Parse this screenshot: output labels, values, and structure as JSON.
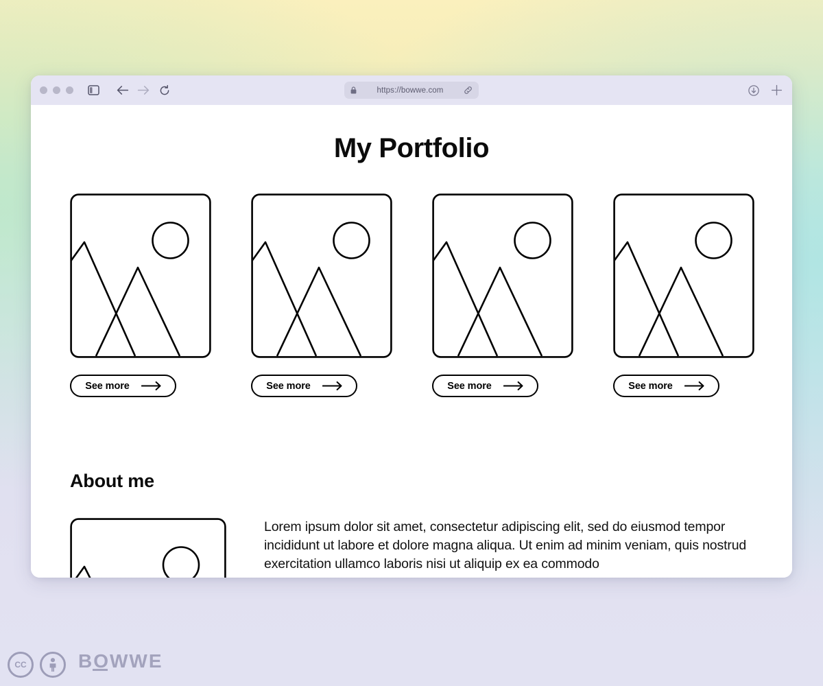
{
  "browser": {
    "traffic_lights": [
      "close",
      "minimize",
      "maximize"
    ],
    "sidebar_toggle_icon": "sidebar-icon",
    "back_icon": "arrow-left-icon",
    "forward_icon": "arrow-right-icon",
    "reload_icon": "reload-icon",
    "lock_icon": "lock-icon",
    "url": "https://bowwe.com",
    "link_icon": "link-icon",
    "download_icon": "download-icon",
    "new_tab_icon": "plus-icon"
  },
  "page": {
    "title": "My Portfolio",
    "portfolio_items": [
      {
        "image_alt": "image-placeholder",
        "button_label": "See more"
      },
      {
        "image_alt": "image-placeholder",
        "button_label": "See more"
      },
      {
        "image_alt": "image-placeholder",
        "button_label": "See more"
      },
      {
        "image_alt": "image-placeholder",
        "button_label": "See more"
      }
    ],
    "about": {
      "heading": "About me",
      "image_alt": "image-placeholder",
      "text": "Lorem ipsum dolor sit amet, consectetur adipiscing elit, sed do eiusmod tempor incididunt ut labore et dolore magna aliqua. Ut enim ad minim veniam, quis nostrud exercitation ullamco laboris nisi ut aliquip ex ea commodo"
    }
  },
  "footer": {
    "cc_badge_label": "CC",
    "by_badge_label": "BY",
    "brand": "BOWWE"
  },
  "colors": {
    "titlebar_bg": "#e5e4f3",
    "url_bar_bg": "#d7d6e6",
    "page_bg": "#ffffff",
    "ink": "#000000",
    "footer_gray": "#a3a3bd",
    "gradient_top": "#fbf0bd",
    "gradient_bottom": "#e2e2f2"
  }
}
